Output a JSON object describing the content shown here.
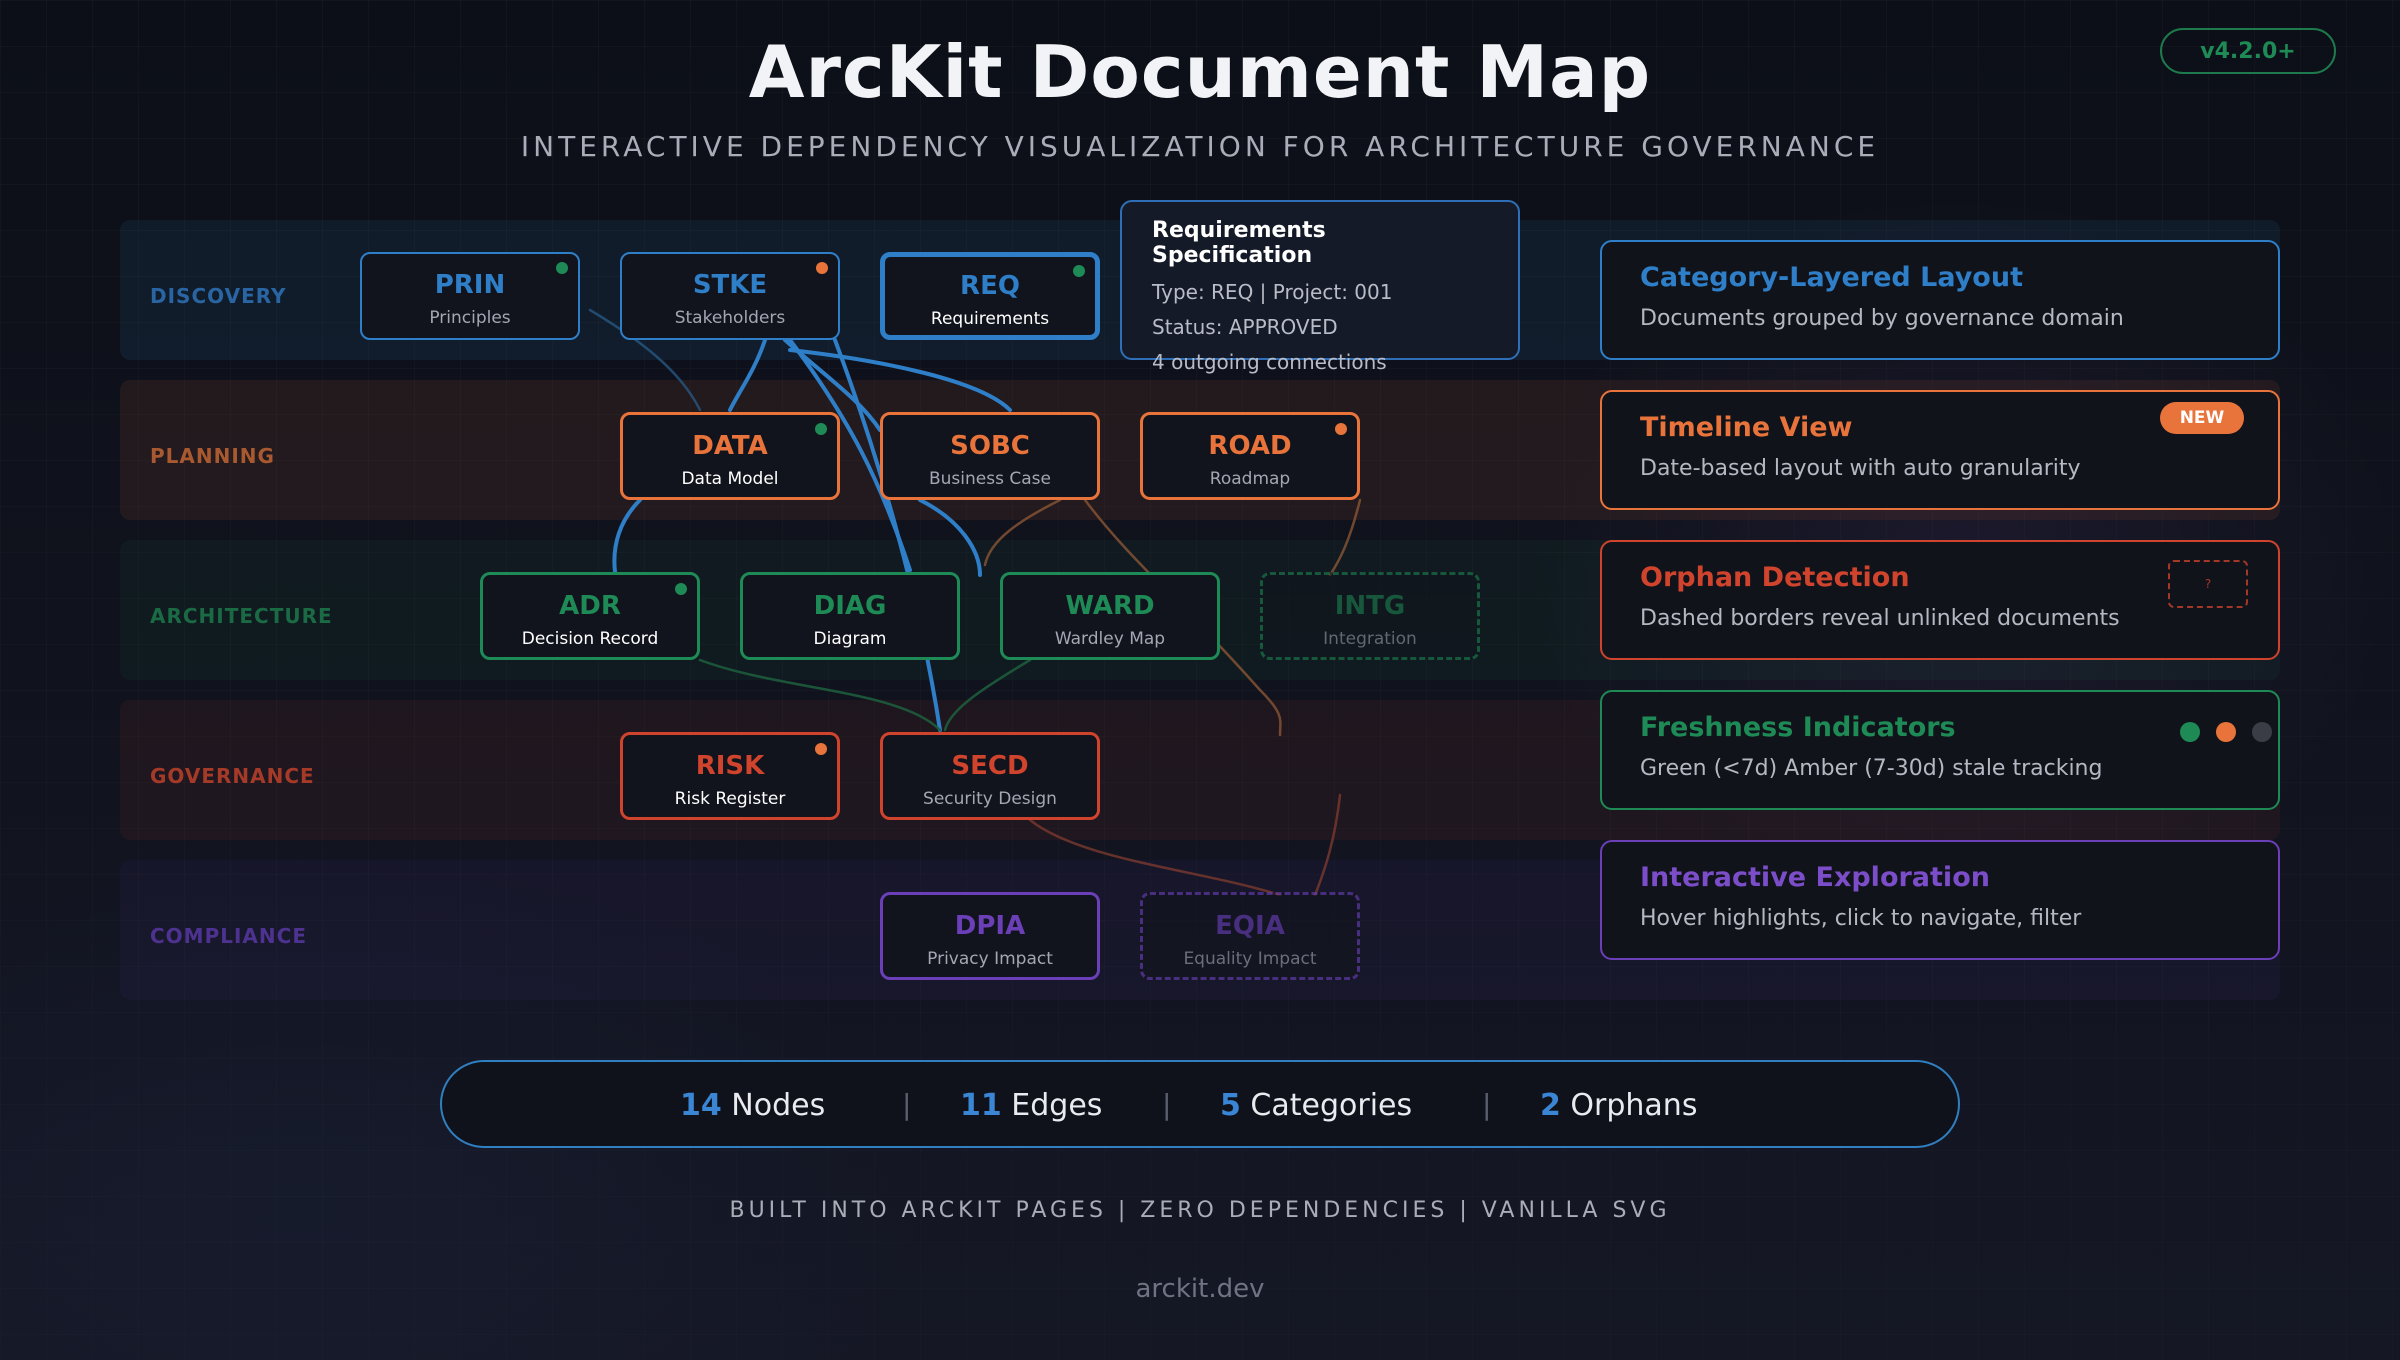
{
  "header": {
    "title": "ArcKit Document Map",
    "subtitle": "INTERACTIVE DEPENDENCY VISUALIZATION FOR ARCHITECTURE GOVERNANCE",
    "version": "v4.2.0+"
  },
  "colors": {
    "discovery": "#2f7fc8",
    "planning": "#e8743b",
    "architecture": "#1e8a55",
    "governance": "#d0432c",
    "compliance": "#6a3fb8",
    "fresh": "#1e8a55",
    "amber": "#e8743b",
    "stale": "#3a3d46"
  },
  "categories": [
    {
      "key": "discovery",
      "label": "DISCOVERY"
    },
    {
      "key": "planning",
      "label": "PLANNING"
    },
    {
      "key": "architecture",
      "label": "ARCHITECTURE"
    },
    {
      "key": "governance",
      "label": "GOVERNANCE"
    },
    {
      "key": "compliance",
      "label": "COMPLIANCE"
    }
  ],
  "nodes": [
    {
      "code": "PRIN",
      "name": "Principles",
      "category": "discovery",
      "freshness": "fresh"
    },
    {
      "code": "STKE",
      "name": "Stakeholders",
      "category": "discovery",
      "freshness": "amber"
    },
    {
      "code": "REQ",
      "name": "Requirements",
      "category": "discovery",
      "freshness": "fresh",
      "selected": true
    },
    {
      "code": "DATA",
      "name": "Data Model",
      "category": "planning",
      "freshness": "fresh"
    },
    {
      "code": "SOBC",
      "name": "Business Case",
      "category": "planning"
    },
    {
      "code": "ROAD",
      "name": "Roadmap",
      "category": "planning",
      "freshness": "amber"
    },
    {
      "code": "ADR",
      "name": "Decision Record",
      "category": "architecture",
      "freshness": "fresh"
    },
    {
      "code": "DIAG",
      "name": "Diagram",
      "category": "architecture"
    },
    {
      "code": "WARD",
      "name": "Wardley Map",
      "category": "architecture"
    },
    {
      "code": "INTG",
      "name": "Integration",
      "category": "architecture",
      "orphan": true
    },
    {
      "code": "RISK",
      "name": "Risk Register",
      "category": "governance",
      "freshness": "amber"
    },
    {
      "code": "SECD",
      "name": "Security Design",
      "category": "governance"
    },
    {
      "code": "DPIA",
      "name": "Privacy Impact",
      "category": "compliance"
    },
    {
      "code": "EQIA",
      "name": "Equality Impact",
      "category": "compliance",
      "orphan": true
    }
  ],
  "tooltip": {
    "title": "Requirements Specification",
    "type_line": "Type: REQ | Project: 001",
    "status_line": "Status: APPROVED",
    "connections_line": "4 outgoing connections"
  },
  "features": [
    {
      "title": "Category-Layered Layout",
      "desc": "Documents grouped by governance domain",
      "color": "#2f7fc8"
    },
    {
      "title": "Timeline View",
      "desc": "Date-based layout with auto granularity",
      "color": "#e8743b",
      "badge": "NEW"
    },
    {
      "title": "Orphan Detection",
      "desc": "Dashed borders reveal unlinked documents",
      "color": "#d0432c",
      "mini": "?"
    },
    {
      "title": "Freshness Indicators",
      "desc": "Green (<7d) Amber (7-30d) stale tracking",
      "color": "#1e8a55"
    },
    {
      "title": "Interactive Exploration",
      "desc": "Hover highlights, click to navigate, filter",
      "color": "#6a3fb8"
    }
  ],
  "stats": [
    {
      "num": "14",
      "label": "Nodes"
    },
    {
      "num": "11",
      "label": "Edges"
    },
    {
      "num": "5",
      "label": "Categories"
    },
    {
      "num": "2",
      "label": "Orphans"
    }
  ],
  "stat_separator": "|",
  "footer": "BUILT INTO ARCKIT PAGES | ZERO DEPENDENCIES | VANILLA SVG",
  "site": "arckit.dev"
}
